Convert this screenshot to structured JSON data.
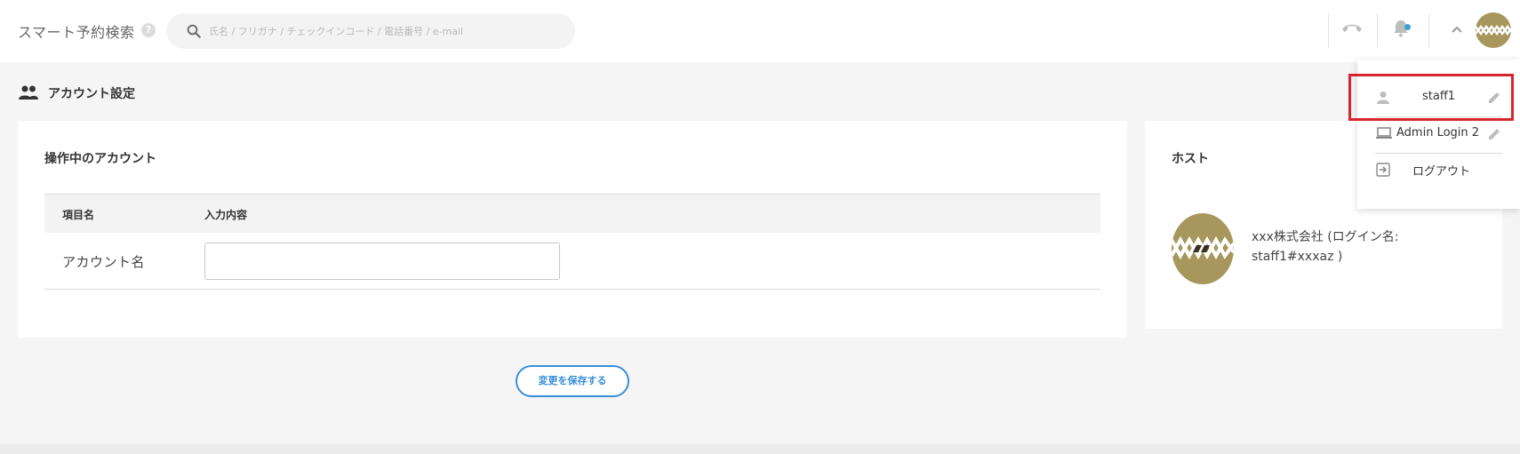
{
  "header": {
    "title": "スマート予約検索",
    "help": "?",
    "search": {
      "placeholder": "氏名 / フリガナ / チェックインコード / 電話番号 / e-mail",
      "value": ""
    },
    "notification_dot_color": "#3aa0dc",
    "brand_color": "#a8975c",
    "icons": [
      "phone-icon",
      "bell-icon",
      "chevron-up-icon",
      "avatar"
    ]
  },
  "page": {
    "title": "アカウント設定",
    "title_icon": "people-icon"
  },
  "account_card": {
    "title": "操作中のアカウント",
    "columns": [
      "項目名",
      "入力内容"
    ],
    "rows": [
      {
        "label": "アカウント名",
        "value": ""
      }
    ]
  },
  "host_card": {
    "title": "ホスト",
    "host_text": "xxx株式会社 (ログイン名: staff1#xxxaz )"
  },
  "save_button": {
    "label": "変更を保存する",
    "color": "#3a8ed8"
  },
  "dropdown": {
    "items": [
      {
        "label": "staff1",
        "icon": "person-icon",
        "edit_icon": "pencil-icon"
      },
      {
        "label": "Admin Login 2",
        "icon": "laptop-icon",
        "edit_icon": "pencil-icon"
      },
      {
        "label": "ログアウト",
        "icon": "logout-icon"
      }
    ],
    "highlight_color": "#d9232d"
  }
}
